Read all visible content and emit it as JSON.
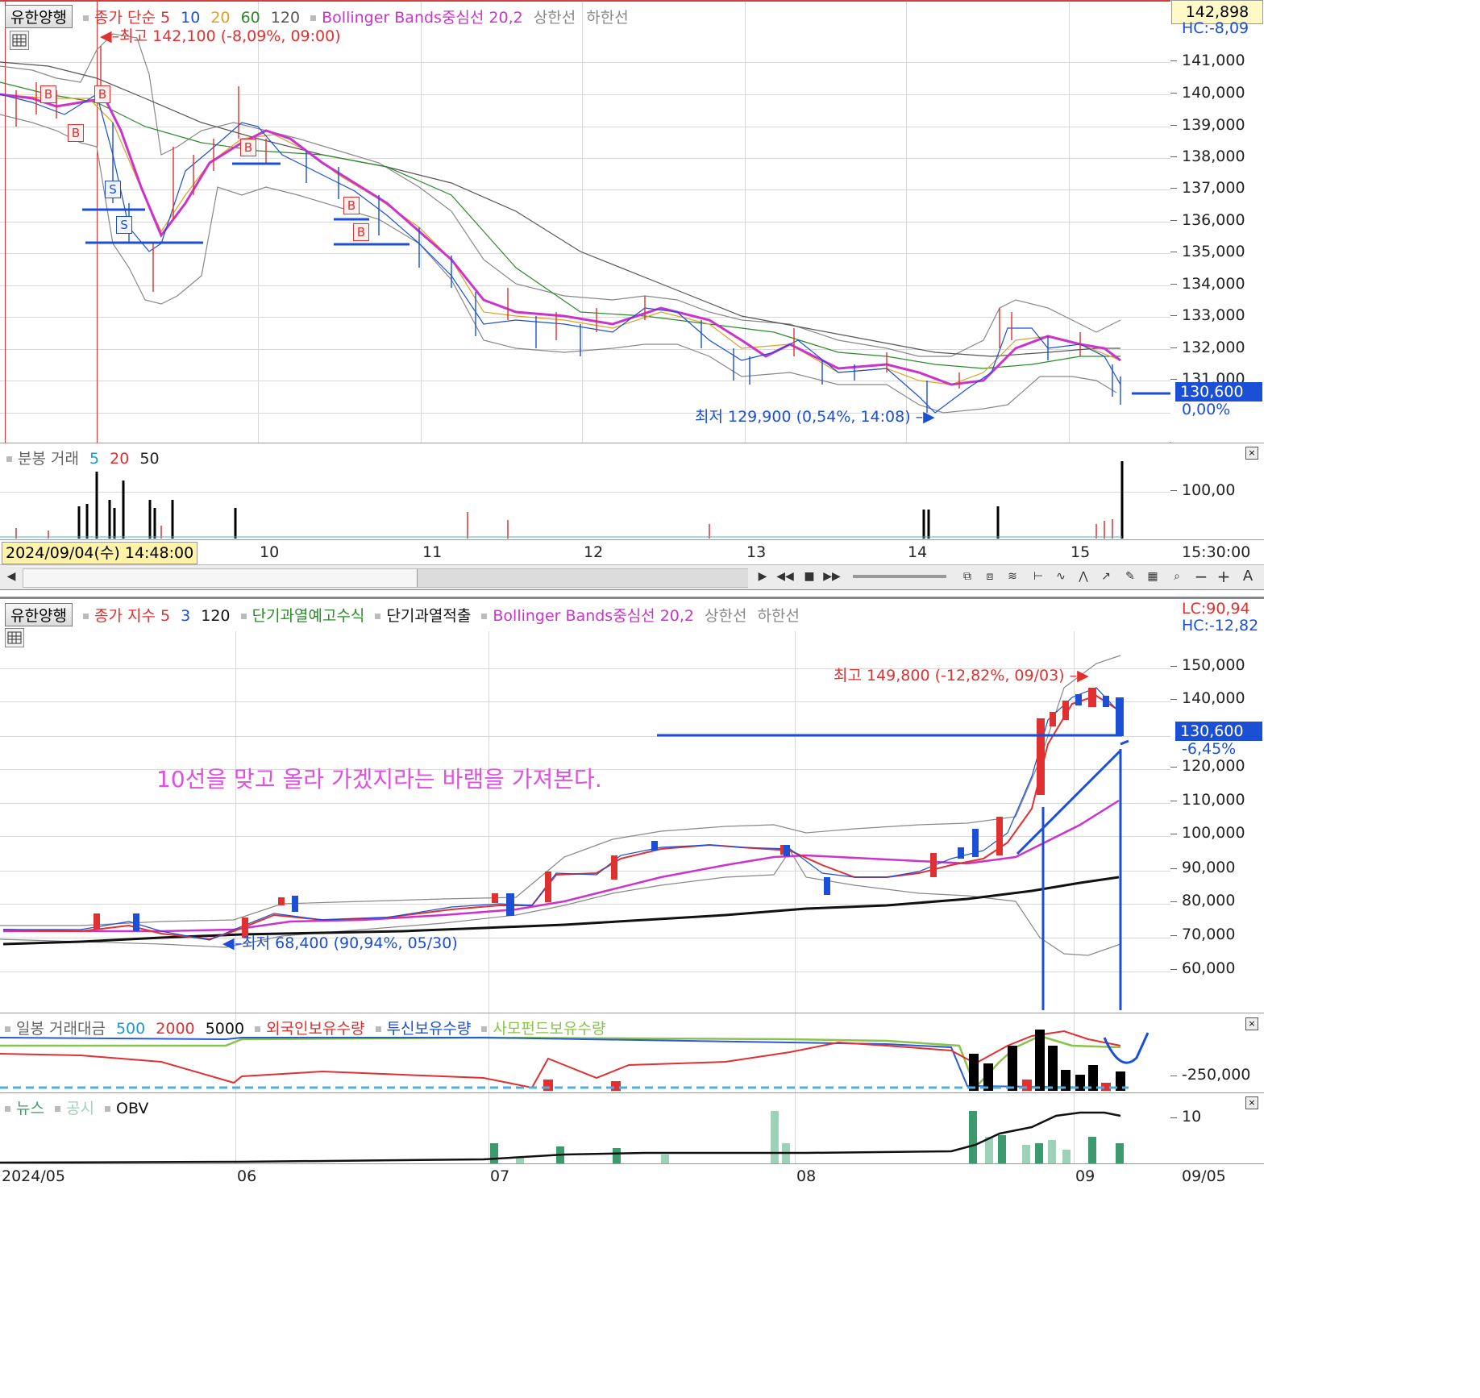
{
  "top_chart": {
    "tab_label": "유한양행",
    "legend_price": "종가 단순 5",
    "legend_ma": [
      "10",
      "20",
      "60",
      "120"
    ],
    "legend_bb": "Bollinger Bands중심선 20,2",
    "legend_upper": "상한선",
    "legend_lower": "하한선",
    "high_annotation": "최고 142,100 (-8,09%, 09:00)",
    "low_annotation": "최저 129,900 (0,54%, 14:08)",
    "current_price_box": "142,898",
    "hc_label": "HC:-8,09",
    "last_price_tag": "130,600",
    "last_pct_tag": "0,00%",
    "y_labels": [
      "141,000",
      "140,000",
      "139,000",
      "138,000",
      "137,000",
      "136,000",
      "135,000",
      "134,000",
      "133,000",
      "132,000",
      "131,000"
    ],
    "signal_badges": [
      "B",
      "B",
      "B",
      "B",
      "B",
      "B",
      "S",
      "S"
    ],
    "volume_legend_title": "분봉 거래",
    "volume_legend_ma": [
      "5",
      "20",
      "50"
    ],
    "volume_y_label": "100,00",
    "cursor_time": "2024/09/04(수) 14:48:00",
    "x_labels": [
      "10",
      "11",
      "12",
      "13",
      "14",
      "15"
    ],
    "x_right_label": "15:30:00"
  },
  "toolbar": {
    "icons": [
      "play-icon",
      "rewind-icon",
      "stop-icon",
      "fast-forward-icon",
      "zoom-icon",
      "minus-icon",
      "plus-icon"
    ],
    "text_a": "A",
    "text_minus": "−",
    "text_plus": "+"
  },
  "bottom_chart": {
    "tab_label": "유한양행",
    "legend_price": "종가 지수 5",
    "legend_ma": [
      "3",
      "120"
    ],
    "legend_warn1": "단기과열예고수식",
    "legend_warn2": "단기과열적출",
    "legend_bb": "Bollinger Bands중심선 20,2",
    "legend_upper": "상한선",
    "legend_lower": "하한선",
    "lc_label": "LC:90,94",
    "hc_label": "HC:-12,82",
    "high_annotation": "최고 149,800 (-12,82%, 09/03)",
    "low_annotation": "최저 68,400 (90,94%, 05/30)",
    "comment": "10선을 맞고 올라 가겠지라는 바램을 가져본다.",
    "last_price_tag": "130,600",
    "last_pct_tag": "-6,45%",
    "y_labels": [
      "150,000",
      "140,000",
      "120,000",
      "110,000",
      "100,000",
      "90,000",
      "80,000",
      "70,000",
      "60,000"
    ],
    "sub1_legend": {
      "title": "일봉 거래대금",
      "ma": [
        "500",
        "2000",
        "5000"
      ],
      "foreign": "외국인보유수량",
      "trust": "투신보유수량",
      "private": "사모펀드보유수량"
    },
    "sub1_y_label": "-250,000",
    "sub2_legend": {
      "news": "뉴스",
      "notice": "공시",
      "obv": "OBV"
    },
    "sub2_y_label": "10",
    "x_labels": [
      "2024/05",
      "06",
      "07",
      "08",
      "09"
    ],
    "x_right_label": "09/05"
  },
  "colors": {
    "up": "#e03030",
    "down": "#2050d0",
    "bb_mid": "#cc33cc",
    "accent_blue": "#1a4fd6",
    "comment": "#e050e0"
  }
}
